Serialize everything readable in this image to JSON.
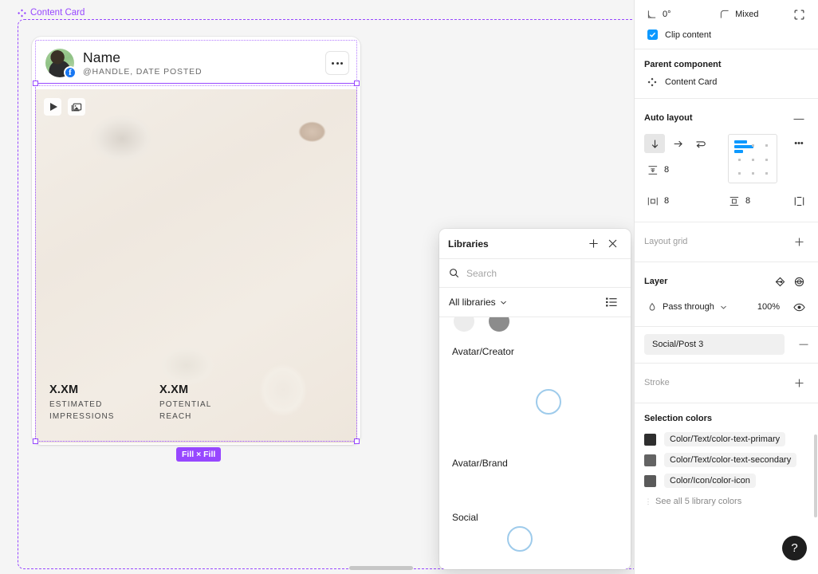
{
  "canvas": {
    "component_label": "Content Card",
    "size_badge": "Fill × Fill",
    "card": {
      "poster_name": "Name",
      "poster_meta": "@HANDLE, DATE POSTED",
      "social_network": "f",
      "stats": [
        {
          "value": "X.XM",
          "label": "ESTIMATED IMPRESSIONS"
        },
        {
          "value": "X.XM",
          "label": "POTENTIAL REACH"
        }
      ],
      "media_tools": [
        "play-icon",
        "image-icon"
      ],
      "more_icon": "ellipsis-icon"
    }
  },
  "libraries": {
    "title": "Libraries",
    "add_label": "+",
    "close_label": "×",
    "search_placeholder": "Search",
    "search_value": "",
    "filter_label": "All libraries",
    "view_icon": "list-view-icon",
    "groups": [
      {
        "name": "Avatar/Creator"
      },
      {
        "name": "Avatar/Brand"
      },
      {
        "name": "Social"
      }
    ]
  },
  "inspector": {
    "rotation": {
      "icon": "rotation-icon",
      "value": "0°"
    },
    "corner_radius": {
      "icon": "corner-radius-icon",
      "value": "Mixed"
    },
    "independent_corners_icon": "independent-corners-icon",
    "clip_content": {
      "label": "Clip content",
      "checked": true
    },
    "parent_component": {
      "title": "Parent component",
      "name": "Content Card"
    },
    "auto_layout": {
      "title": "Auto layout",
      "collapse_label": "—",
      "more_label": "•••",
      "direction_modes": [
        "vertical-icon",
        "horizontal-icon",
        "wrap-icon"
      ],
      "active_mode": 0,
      "gap": "8",
      "padding_horizontal": "8",
      "padding_vertical": "8"
    },
    "layout_grid": {
      "title": "Layout grid",
      "add_label": "+"
    },
    "layer": {
      "title": "Layer",
      "blend_mode": "Pass through",
      "opacity": "100%",
      "visibility_icon": "eye-icon",
      "effects_icon": "effects-icon",
      "blur_icon": "blur-icon"
    },
    "style_row": {
      "name": "Social/Post 3",
      "remove_label": "—"
    },
    "stroke": {
      "title": "Stroke",
      "add_label": "+"
    },
    "selection_colors": {
      "title": "Selection colors",
      "items": [
        {
          "name": "Color/Text/color-text-primary",
          "hex": "#2e2e2e"
        },
        {
          "name": "Color/Text/color-text-secondary",
          "hex": "#636363"
        },
        {
          "name": "Color/Icon/color-icon",
          "hex": "#5a5a5a"
        }
      ],
      "see_all": "See all 5 library colors"
    },
    "help_label": "?"
  }
}
